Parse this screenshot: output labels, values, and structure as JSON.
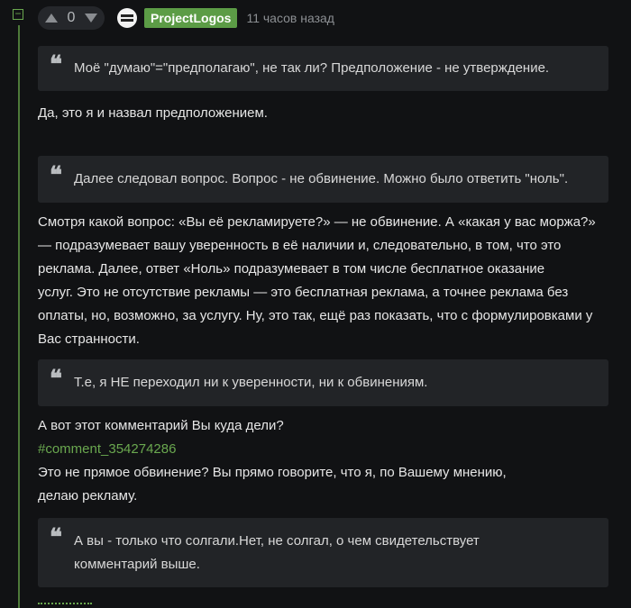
{
  "comment": {
    "votes": "0",
    "author": "ProjectLogos",
    "time": "11 часов назад",
    "toggle": "−"
  },
  "body": {
    "quote1": "Моё \"думаю\"=\"предполагаю\", не так ли? Предположение - не утверждение.",
    "para1": "Да, это я и назвал предположением.",
    "quote2": "Далее следовал вопрос. Вопрос - не обвинение. Можно было ответить \"ноль\".",
    "para2_lines": [
      "Смотря какой вопрос: «Вы её рекламируете?» — не обвинение. А «какая у вас моржа?»",
      "— подразумевает вашу уверенность в её наличии и, следовательно, в том, что это",
      "реклама. Далее, ответ «Ноль» подразумевает в том числе бесплатное оказание",
      "услуг. Это не отсутствие рекламы — это бесплатная реклама, а точнее реклама без",
      "оплаты, но, возможно, за услугу. Ну, это так, ещё раз показать, что с формулировками у",
      "Вас странности."
    ],
    "quote3": "Т.е, я НЕ переходил ни к уверенности, ни к обвинениям.",
    "para3": "А вот этот комментарий Вы куда дели?",
    "comment_link": "#comment_354274286",
    "para4_lines": [
      "Это не прямое обвинение? Вы прямо говорите, что я, по Вашему мнению,",
      "делаю рекламу."
    ],
    "quote4_lines": [
      "А вы - только что солгали.Нет, не солгал, о чем свидетельствует",
      "комментарий выше."
    ],
    "quote_mark": "❝"
  },
  "colors": {
    "background": "#111214",
    "accent_green": "#5c9c46",
    "quote_bg": "#222427",
    "link_green": "#6aa84f"
  },
  "icons": [
    "collapse-icon",
    "upvote-icon",
    "downvote-icon",
    "avatar",
    "quote-icon"
  ]
}
